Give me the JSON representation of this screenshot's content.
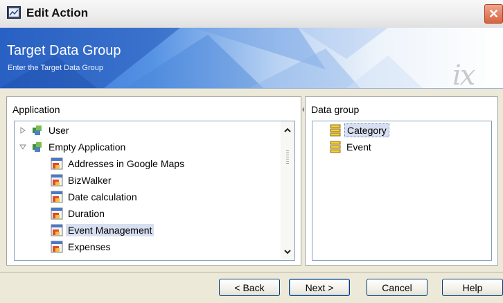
{
  "window": {
    "title": "Edit Action",
    "close_glyph": "✕"
  },
  "banner": {
    "title": "Target Data Group",
    "subtitle": "Enter the Target Data Group",
    "logo_text": "ix"
  },
  "application_panel": {
    "header": "Application",
    "items": [
      {
        "label": "User",
        "icon": "user-app-icon",
        "expander": "collapsed"
      },
      {
        "label": "Empty Application",
        "icon": "application-icon",
        "expander": "expanded"
      },
      {
        "label": "Addresses in Google Maps",
        "icon": "form-icon"
      },
      {
        "label": "BizWalker",
        "icon": "form-icon"
      },
      {
        "label": "Date calculation",
        "icon": "form-icon"
      },
      {
        "label": "Duration",
        "icon": "form-icon"
      },
      {
        "label": "Event Management",
        "icon": "form-icon",
        "selected": true
      },
      {
        "label": "Expenses",
        "icon": "form-icon"
      }
    ]
  },
  "data_group_panel": {
    "header": "Data group",
    "items": [
      {
        "label": "Category",
        "icon": "database-icon",
        "selected": true
      },
      {
        "label": "Event",
        "icon": "database-icon"
      }
    ]
  },
  "buttons": {
    "back": "< Back",
    "next": "Next >",
    "cancel": "Cancel",
    "help": "Help"
  }
}
